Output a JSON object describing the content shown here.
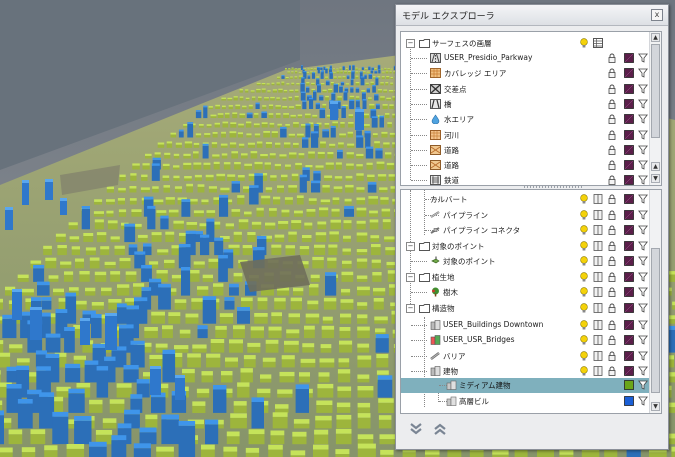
{
  "window": {
    "title": "モデル エクスプローラ",
    "close_label": "x"
  },
  "colors": {
    "selection": "#7fb0bd",
    "layer_purple": "#5b1f4a",
    "layer_green": "#6aa519",
    "layer_blue": "#1a5fd6",
    "lightbulb": "#f4d20a",
    "building_green": "#c5e35a",
    "building_blue": "#3f95ea"
  },
  "top_tree": {
    "root_label": "サーフェスの画層",
    "items": [
      {
        "label": "USER_Presidio_Parkway",
        "icon": "road-icon"
      },
      {
        "label": "カバレッジ エリア",
        "icon": "coverage-icon"
      },
      {
        "label": "交差点",
        "icon": "intersection-icon"
      },
      {
        "label": "橋",
        "icon": "bridge-icon"
      },
      {
        "label": "水エリア",
        "icon": "water-icon"
      },
      {
        "label": "河川",
        "icon": "river-icon"
      },
      {
        "label": "道路",
        "icon": "street-icon"
      },
      {
        "label": "道路",
        "icon": "street-icon"
      },
      {
        "label": "鉄道",
        "icon": "railway-icon"
      }
    ]
  },
  "bottom_tree": {
    "items": [
      {
        "label": "カルバート",
        "level": 2
      },
      {
        "label": "パイプライン",
        "level": 2
      },
      {
        "label": "パイプライン コネクタ",
        "level": 2
      },
      {
        "label": "対象のポイント",
        "level": 0
      },
      {
        "label": "対象のポイント",
        "level": 1
      },
      {
        "label": "植生地",
        "level": 0
      },
      {
        "label": "樹木",
        "level": 1
      },
      {
        "label": "構造物",
        "level": 0
      },
      {
        "label": "USER_Buildings Downtown",
        "level": 1
      },
      {
        "label": "USER_USR_Bridges",
        "level": 1
      },
      {
        "label": "バリア",
        "level": 1
      },
      {
        "label": "建物",
        "level": 1
      },
      {
        "label": "ミディアム建物",
        "level": 2
      },
      {
        "label": "高層ビル",
        "level": 2
      }
    ]
  },
  "footer": {
    "expand_all": "expand-all",
    "collapse_all": "collapse-all"
  }
}
